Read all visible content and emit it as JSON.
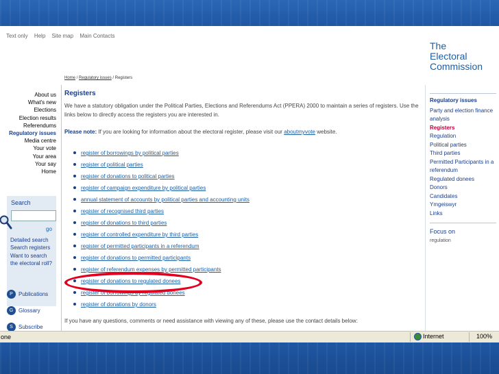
{
  "top_links": [
    "Text only",
    "Help",
    "Site map",
    "Main Contacts"
  ],
  "logo": {
    "line1": "The",
    "line2": "Electoral",
    "line3": "Commission"
  },
  "breadcrumb": {
    "home": "Home",
    "sep1": " / ",
    "issues": "Regulatory issues",
    "sep2": " / ",
    "current": "Registers"
  },
  "left_nav": [
    {
      "label": "About us"
    },
    {
      "label": "What's new"
    },
    {
      "label": "Elections"
    },
    {
      "label": "Election results"
    },
    {
      "label": "Referendums"
    },
    {
      "label": "Regulatory issues",
      "active": true
    },
    {
      "label": "Media centre"
    },
    {
      "label": "Your vote"
    },
    {
      "label": "Your area"
    },
    {
      "label": "Your say"
    },
    {
      "label": "Home"
    }
  ],
  "search": {
    "title": "Search",
    "value": "",
    "go": "go",
    "links": [
      "Detailed search",
      "Search registers",
      "Want to search",
      "the electoral roll?"
    ]
  },
  "tools": [
    {
      "label": "Publications",
      "icon": "publications-icon"
    },
    {
      "label": "Glossary",
      "icon": "glossary-icon"
    },
    {
      "label": "Subscribe",
      "icon": "subscribe-icon"
    }
  ],
  "main": {
    "title": "Registers",
    "intro": "We have a statutory obligation under the Political Parties, Elections and Referendums Act (PPERA) 2000 to maintain a series of registers. Use the links below to directly access the registers you are interested in.",
    "note_label": "Please note:",
    "note_text": " If you are looking for information about the electoral register, please visit our ",
    "note_link": "aboutmyvote",
    "note_end": " website.",
    "registers": [
      "register of borrowings by political parties",
      "register of political parties",
      "register of donations to political parties",
      "register of campaign expenditure by political parties",
      "annual statement of accounts by political parties and accounting units",
      "register of recognised third parties",
      "register of donations to third parties",
      "register of controlled expenditure by third parties",
      "register of permitted participants in a referendum",
      "register of donations to permitted participants",
      "register of referendum expenses by permitted participants",
      "register of donations to regulated donees",
      "register of borrowings by regulated donees",
      "register of donations by donors"
    ],
    "contact": "If you have any questions, comments or need assistance with viewing any of these, please use the contact details below:"
  },
  "right_nav": {
    "heading": "Regulatory issues",
    "items": [
      {
        "label": "Party and election finance analysis"
      },
      {
        "label": "Registers",
        "active": true
      },
      {
        "label": "Regulation"
      },
      {
        "label": "Political parties"
      },
      {
        "label": "Third parties"
      },
      {
        "label": "Permitted Participants in a referendum"
      },
      {
        "label": "Regulated donees"
      },
      {
        "label": "Donors"
      },
      {
        "label": "Candidates"
      },
      {
        "label": "Ymgeiswyr"
      },
      {
        "label": "Links"
      }
    ],
    "focus_title": "Focus on",
    "focus_sub": "regulation"
  },
  "status": {
    "left": "one",
    "zone": "Internet",
    "zoom": "100%"
  },
  "colors": {
    "accent": "#1a3e8a",
    "link": "#1a5ea8",
    "active": "#c0003a",
    "highlight_circle": "#e3001f",
    "frame": "#1f57a3"
  }
}
